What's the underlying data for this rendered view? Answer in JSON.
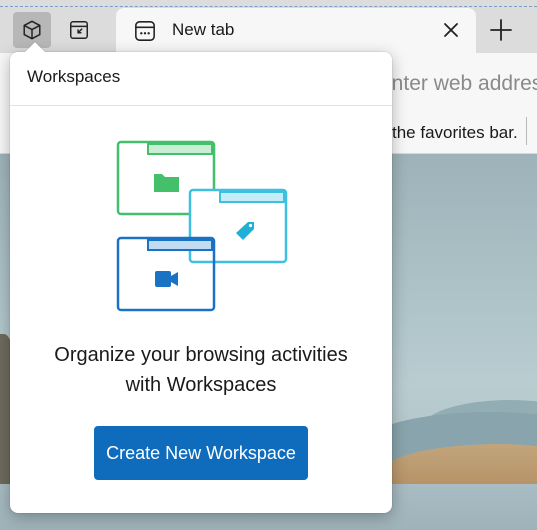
{
  "tabstrip": {
    "workspaces_icon": "workspaces-cube-icon",
    "vertical_tabs_icon": "tab-actions-icon",
    "tab": {
      "title": "New tab",
      "icon": "new-tab-page-icon",
      "close_icon": "close-icon"
    },
    "new_tab_icon": "plus-icon"
  },
  "toolbar": {
    "address_placeholder": "enter web address"
  },
  "favorites_bar": {
    "text": "the favorites bar."
  },
  "popup": {
    "title": "Workspaces",
    "message_line1": "Organize your browsing activities",
    "message_line2": "with Workspaces",
    "create_button": "Create New Workspace",
    "illustration_icons": [
      "folder-icon",
      "tag-icon",
      "video-camera-icon"
    ]
  },
  "colors": {
    "accent": "#0f6cbd",
    "green_window": "#45c06a",
    "cyan_window": "#3ec0e0",
    "blue_window": "#1a72c4"
  }
}
